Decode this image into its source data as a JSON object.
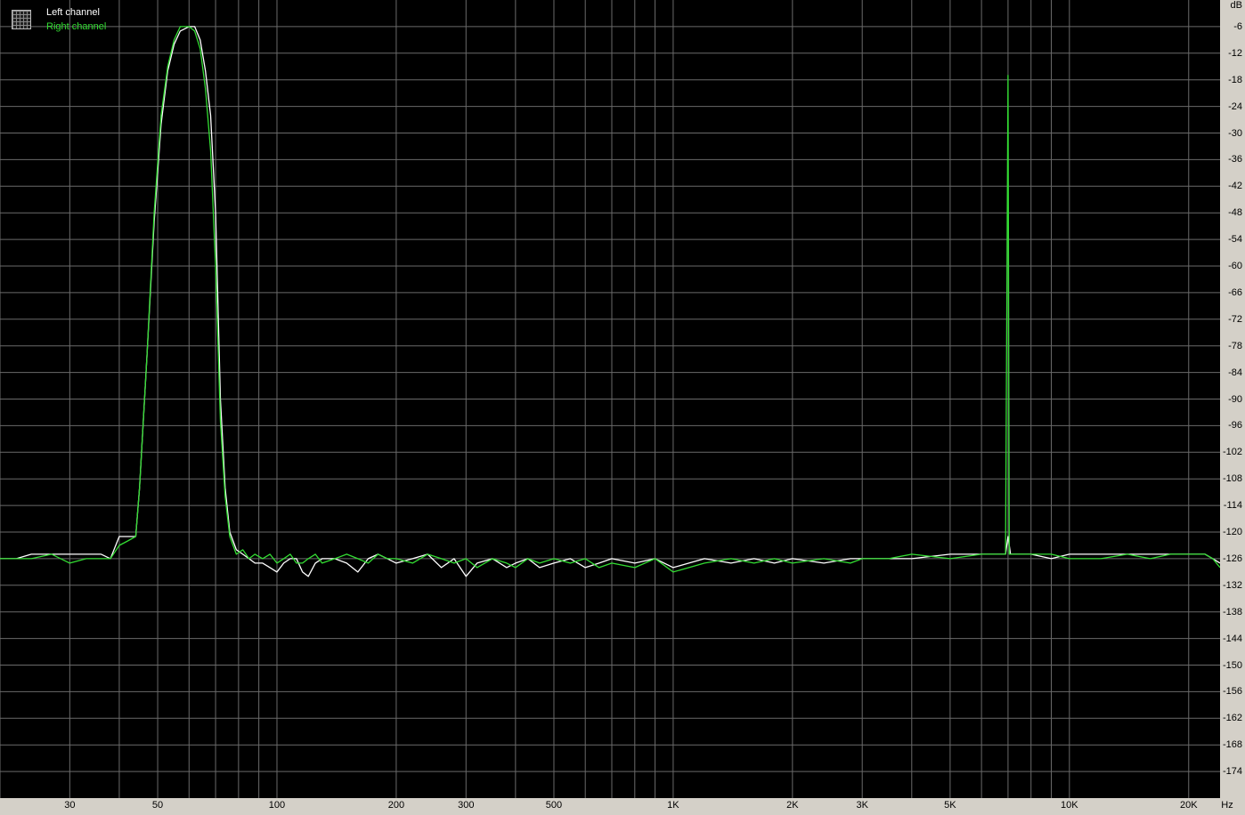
{
  "chart_data": {
    "type": "line",
    "x_scale": "log",
    "xlim": [
      20,
      24000
    ],
    "ylim": [
      -180,
      0
    ],
    "ylabel": "dB",
    "xlabel": "Hz",
    "y_ticks": [
      "-6",
      "-12",
      "-18",
      "-24",
      "-30",
      "-36",
      "-42",
      "-48",
      "-54",
      "-60",
      "-66",
      "-72",
      "-78",
      "-84",
      "-90",
      "-96",
      "-102",
      "-108",
      "-114",
      "-120",
      "-126",
      "-132",
      "-138",
      "-144",
      "-150",
      "-156",
      "-162",
      "-168",
      "-174"
    ],
    "x_ticks": [
      "30",
      "50",
      "100",
      "200",
      "300",
      "500",
      "1K",
      "2K",
      "3K",
      "5K",
      "10K",
      "20K"
    ],
    "grid": true,
    "legend": "top-left",
    "series": [
      {
        "name": "Left channel",
        "color": "#ffffff",
        "points": [
          [
            20,
            -126
          ],
          [
            22,
            -126
          ],
          [
            24,
            -125
          ],
          [
            27,
            -125
          ],
          [
            30,
            -125
          ],
          [
            33,
            -125
          ],
          [
            36,
            -125
          ],
          [
            38,
            -126
          ],
          [
            40,
            -121
          ],
          [
            42,
            -121
          ],
          [
            44,
            -121
          ],
          [
            45,
            -110
          ],
          [
            47,
            -80
          ],
          [
            49,
            -50
          ],
          [
            51,
            -28
          ],
          [
            53,
            -16
          ],
          [
            55,
            -10
          ],
          [
            57,
            -7
          ],
          [
            60,
            -6
          ],
          [
            62,
            -6
          ],
          [
            64,
            -9
          ],
          [
            66,
            -16
          ],
          [
            68,
            -26
          ],
          [
            70,
            -48
          ],
          [
            72,
            -90
          ],
          [
            74,
            -110
          ],
          [
            76,
            -120
          ],
          [
            79,
            -124
          ],
          [
            82,
            -125
          ],
          [
            85,
            -126
          ],
          [
            88,
            -127
          ],
          [
            92,
            -127
          ],
          [
            96,
            -128
          ],
          [
            100,
            -129
          ],
          [
            104,
            -127
          ],
          [
            108,
            -126
          ],
          [
            112,
            -126
          ],
          [
            116,
            -129
          ],
          [
            120,
            -130
          ],
          [
            125,
            -127
          ],
          [
            130,
            -126
          ],
          [
            140,
            -126
          ],
          [
            150,
            -127
          ],
          [
            160,
            -129
          ],
          [
            170,
            -126
          ],
          [
            180,
            -125
          ],
          [
            190,
            -126
          ],
          [
            200,
            -127
          ],
          [
            220,
            -126
          ],
          [
            240,
            -125
          ],
          [
            260,
            -128
          ],
          [
            280,
            -126
          ],
          [
            300,
            -130
          ],
          [
            320,
            -127
          ],
          [
            350,
            -126
          ],
          [
            380,
            -128
          ],
          [
            400,
            -127
          ],
          [
            430,
            -126
          ],
          [
            460,
            -128
          ],
          [
            500,
            -127
          ],
          [
            550,
            -126
          ],
          [
            600,
            -128
          ],
          [
            650,
            -127
          ],
          [
            700,
            -126
          ],
          [
            800,
            -127
          ],
          [
            900,
            -126
          ],
          [
            1000,
            -128
          ],
          [
            1200,
            -126
          ],
          [
            1400,
            -127
          ],
          [
            1600,
            -126
          ],
          [
            1800,
            -127
          ],
          [
            2000,
            -126
          ],
          [
            2400,
            -127
          ],
          [
            2800,
            -126
          ],
          [
            3000,
            -126
          ],
          [
            3500,
            -126
          ],
          [
            4000,
            -126
          ],
          [
            5000,
            -125
          ],
          [
            6000,
            -125
          ],
          [
            6500,
            -125
          ],
          [
            6900,
            -125
          ],
          [
            7000,
            -121
          ],
          [
            7100,
            -125
          ],
          [
            8000,
            -125
          ],
          [
            9000,
            -126
          ],
          [
            10000,
            -125
          ],
          [
            12000,
            -125
          ],
          [
            14000,
            -125
          ],
          [
            16000,
            -125
          ],
          [
            18000,
            -125
          ],
          [
            20000,
            -125
          ],
          [
            22000,
            -125
          ],
          [
            23000,
            -126
          ],
          [
            24000,
            -127
          ]
        ]
      },
      {
        "name": "Right channel",
        "color": "#33dd33",
        "points": [
          [
            20,
            -126
          ],
          [
            22,
            -126
          ],
          [
            24,
            -126
          ],
          [
            27,
            -125
          ],
          [
            30,
            -127
          ],
          [
            33,
            -126
          ],
          [
            36,
            -126
          ],
          [
            38,
            -126
          ],
          [
            40,
            -123
          ],
          [
            42,
            -122
          ],
          [
            44,
            -121
          ],
          [
            45,
            -110
          ],
          [
            47,
            -80
          ],
          [
            49,
            -48
          ],
          [
            51,
            -26
          ],
          [
            53,
            -15
          ],
          [
            55,
            -9
          ],
          [
            57,
            -6
          ],
          [
            60,
            -6
          ],
          [
            62,
            -7
          ],
          [
            64,
            -11
          ],
          [
            66,
            -20
          ],
          [
            68,
            -34
          ],
          [
            70,
            -60
          ],
          [
            72,
            -95
          ],
          [
            74,
            -112
          ],
          [
            76,
            -121
          ],
          [
            79,
            -125
          ],
          [
            82,
            -124
          ],
          [
            85,
            -126
          ],
          [
            88,
            -125
          ],
          [
            92,
            -126
          ],
          [
            96,
            -125
          ],
          [
            100,
            -127
          ],
          [
            104,
            -126
          ],
          [
            108,
            -125
          ],
          [
            112,
            -127
          ],
          [
            116,
            -127
          ],
          [
            120,
            -126
          ],
          [
            125,
            -125
          ],
          [
            130,
            -127
          ],
          [
            140,
            -126
          ],
          [
            150,
            -125
          ],
          [
            160,
            -126
          ],
          [
            170,
            -127
          ],
          [
            180,
            -125
          ],
          [
            190,
            -126
          ],
          [
            200,
            -126
          ],
          [
            220,
            -127
          ],
          [
            240,
            -125
          ],
          [
            260,
            -126
          ],
          [
            280,
            -127
          ],
          [
            300,
            -126
          ],
          [
            320,
            -128
          ],
          [
            350,
            -126
          ],
          [
            380,
            -127
          ],
          [
            400,
            -128
          ],
          [
            430,
            -126
          ],
          [
            460,
            -127
          ],
          [
            500,
            -126
          ],
          [
            550,
            -127
          ],
          [
            600,
            -126
          ],
          [
            650,
            -128
          ],
          [
            700,
            -127
          ],
          [
            800,
            -128
          ],
          [
            900,
            -126
          ],
          [
            1000,
            -129
          ],
          [
            1200,
            -127
          ],
          [
            1400,
            -126
          ],
          [
            1600,
            -127
          ],
          [
            1800,
            -126
          ],
          [
            2000,
            -127
          ],
          [
            2400,
            -126
          ],
          [
            2800,
            -127
          ],
          [
            3000,
            -126
          ],
          [
            3500,
            -126
          ],
          [
            4000,
            -125
          ],
          [
            5000,
            -126
          ],
          [
            6000,
            -125
          ],
          [
            6500,
            -125
          ],
          [
            6800,
            -125
          ],
          [
            6900,
            -125
          ],
          [
            7000,
            -17
          ],
          [
            7050,
            -125
          ],
          [
            7100,
            -125
          ],
          [
            8000,
            -125
          ],
          [
            9000,
            -125
          ],
          [
            10000,
            -126
          ],
          [
            12000,
            -126
          ],
          [
            14000,
            -125
          ],
          [
            16000,
            -126
          ],
          [
            18000,
            -125
          ],
          [
            20000,
            -125
          ],
          [
            22000,
            -125
          ],
          [
            23000,
            -126
          ],
          [
            24000,
            -128
          ]
        ]
      }
    ]
  }
}
